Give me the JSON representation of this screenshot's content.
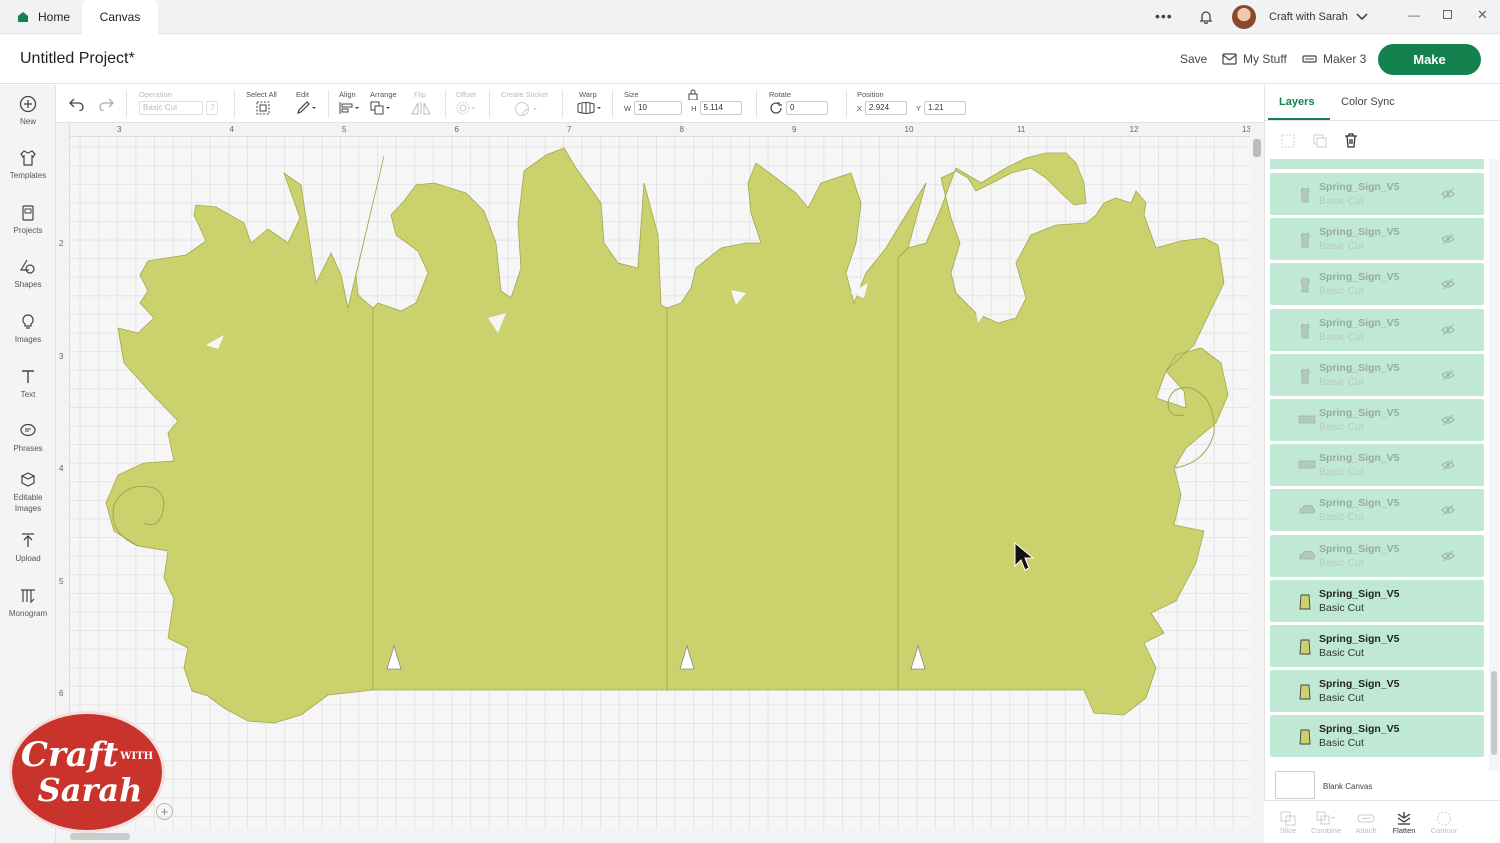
{
  "tabs": {
    "home": "Home",
    "canvas": "Canvas"
  },
  "account": {
    "name": "Craft with Sarah"
  },
  "header": {
    "title": "Untitled Project*",
    "save": "Save",
    "my_stuff": "My Stuff",
    "machine": "Maker 3",
    "make": "Make"
  },
  "left_tools": [
    {
      "label": "New",
      "icon": "plus-circle-icon"
    },
    {
      "label": "Templates",
      "icon": "shirt-icon"
    },
    {
      "label": "Projects",
      "icon": "projects-icon"
    },
    {
      "label": "Shapes",
      "icon": "shapes-icon"
    },
    {
      "label": "Images",
      "icon": "lightbulb-icon"
    },
    {
      "label": "Text",
      "icon": "text-icon"
    },
    {
      "label": "Phrases",
      "icon": "speech-bubble-icon"
    },
    {
      "label": "Editable Images",
      "icon": "edit-image-icon"
    },
    {
      "label": "Upload",
      "icon": "upload-icon"
    },
    {
      "label": "Monogram",
      "icon": "monogram-icon"
    }
  ],
  "toolbar": {
    "operation_label": "Operation",
    "operation_value": "Basic Cut",
    "select_all": "Select All",
    "edit": "Edit",
    "align": "Align",
    "arrange": "Arrange",
    "flip": "Flip",
    "offset": "Offset",
    "create_sticker": "Create Sticker",
    "warp": "Warp",
    "size": "Size",
    "w_label": "W",
    "w_value": "10",
    "h_label": "H",
    "h_value": "5.114",
    "rotate": "Rotate",
    "rotate_value": "0",
    "position": "Position",
    "x_label": "X",
    "x_value": "2.924",
    "y_label": "Y",
    "y_value": "1.21"
  },
  "ruler": {
    "top": [
      "3",
      "4",
      "5",
      "6",
      "7",
      "8",
      "9",
      "10",
      "11",
      "12",
      "13"
    ],
    "left": [
      "2",
      "3",
      "4",
      "5",
      "6"
    ]
  },
  "right_panel": {
    "tabs": [
      "Layers",
      "Color Sync"
    ],
    "layers": [
      {
        "name": "Spring_Sign_V5",
        "type": "Basic Cut",
        "hidden": true
      },
      {
        "name": "Spring_Sign_V5",
        "type": "Basic Cut",
        "hidden": true
      },
      {
        "name": "Spring_Sign_V5",
        "type": "Basic Cut",
        "hidden": true
      },
      {
        "name": "Spring_Sign_V5",
        "type": "Basic Cut",
        "hidden": true
      },
      {
        "name": "Spring_Sign_V5",
        "type": "Basic Cut",
        "hidden": true
      },
      {
        "name": "Spring_Sign_V5",
        "type": "Basic Cut",
        "hidden": true
      },
      {
        "name": "Spring_Sign_V5",
        "type": "Basic Cut",
        "hidden": true
      },
      {
        "name": "Spring_Sign_V5",
        "type": "Basic Cut",
        "hidden": true
      },
      {
        "name": "Spring_Sign_V5",
        "type": "Basic Cut",
        "hidden": true
      },
      {
        "name": "Spring_Sign_V5",
        "type": "Basic Cut",
        "hidden": false
      },
      {
        "name": "Spring_Sign_V5",
        "type": "Basic Cut",
        "hidden": false
      },
      {
        "name": "Spring_Sign_V5",
        "type": "Basic Cut",
        "hidden": false
      },
      {
        "name": "Spring_Sign_V5",
        "type": "Basic Cut",
        "hidden": false
      }
    ],
    "blank_canvas": "Blank Canvas",
    "bottom_tools": [
      "Slice",
      "Combine",
      "Attach",
      "Flatten",
      "Contour"
    ]
  },
  "logo": {
    "line1": "Craft",
    "with": "WITH",
    "line2": "Sarah"
  },
  "colors": {
    "accent": "#13824f",
    "shape": "#cbd16c",
    "layer_bg": "#bfe9d5",
    "logo": "#c8332c"
  }
}
